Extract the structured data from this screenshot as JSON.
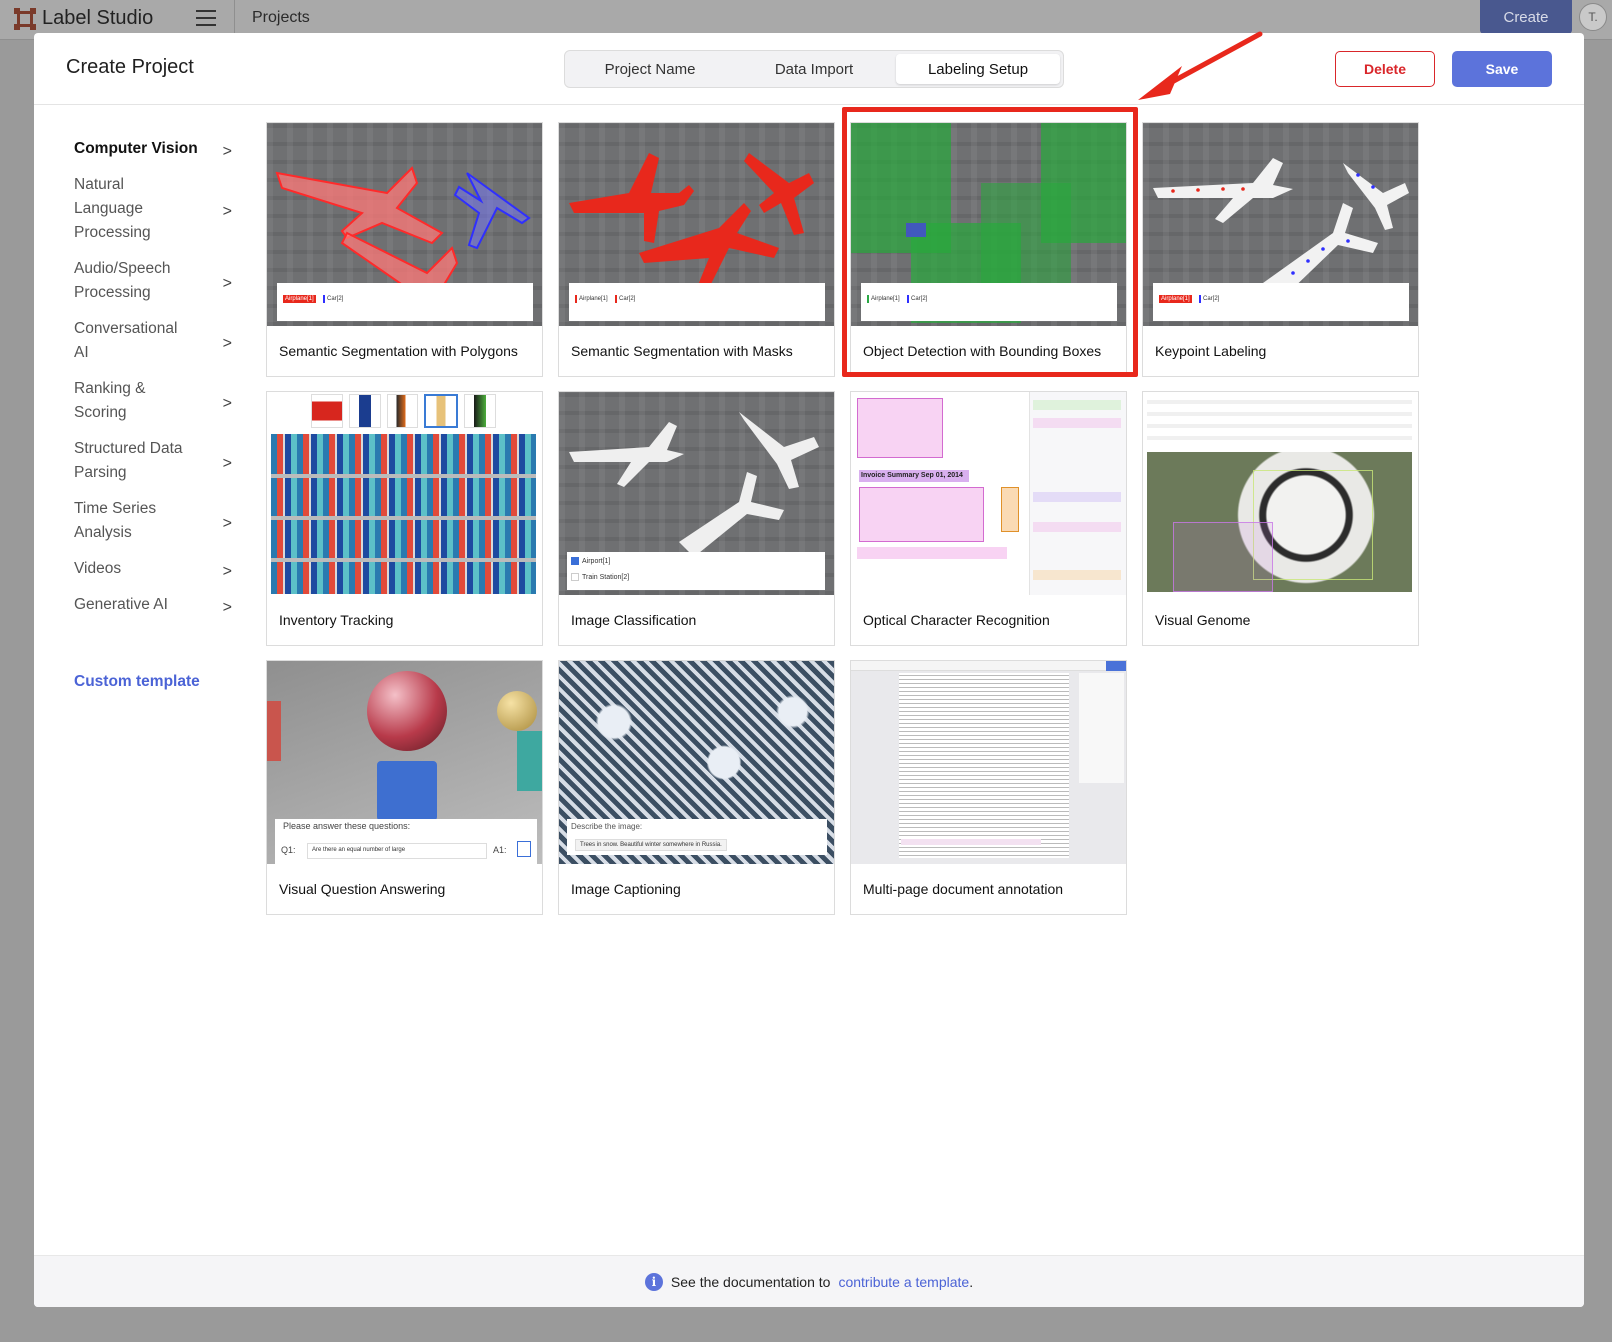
{
  "app": {
    "title": "Label Studio",
    "breadcrumb": "Projects",
    "create_label": "Create",
    "avatar_initial": "T."
  },
  "modal": {
    "title": "Create Project",
    "steps": [
      "Project Name",
      "Data Import",
      "Labeling Setup"
    ],
    "active_step": "Labeling Setup",
    "delete_label": "Delete",
    "save_label": "Save"
  },
  "sidebar": {
    "categories": [
      {
        "label": "Computer Vision",
        "active": true
      },
      {
        "label": "Natural Language Processing"
      },
      {
        "label": "Audio/Speech Processing"
      },
      {
        "label": "Conversational AI"
      },
      {
        "label": "Ranking & Scoring"
      },
      {
        "label": "Structured Data Parsing"
      },
      {
        "label": "Time Series Analysis"
      },
      {
        "label": "Videos"
      },
      {
        "label": "Generative AI"
      }
    ],
    "custom_template": "Custom template",
    "chevron": ">"
  },
  "templates": [
    {
      "label": "Semantic Segmentation with Polygons",
      "tags": [
        "Airplane[1]",
        "Car[2]"
      ]
    },
    {
      "label": "Semantic Segmentation with Masks",
      "tags": [
        "Airplane[1]",
        "Car[2]"
      ]
    },
    {
      "label": "Object Detection with Bounding Boxes",
      "tags": [
        "Airplane[1]",
        "Car[2]"
      ],
      "selected": true
    },
    {
      "label": "Keypoint Labeling",
      "tags": [
        "Airplane[1]",
        "Car[2]"
      ]
    },
    {
      "label": "Inventory Tracking"
    },
    {
      "label": "Image Classification",
      "options": [
        "Airport[1]",
        "Train Station[2]"
      ]
    },
    {
      "label": "Optical Character Recognition",
      "snippet": "Invoice Summary Sep 01, 2014"
    },
    {
      "label": "Visual Genome"
    },
    {
      "label": "Visual Question Answering",
      "prompt": "Please answer these questions:",
      "q": "Q1:",
      "a": "A1:",
      "question_text": "Are there an equal number of large"
    },
    {
      "label": "Image Captioning",
      "prompt": "Describe the image:",
      "caption": "Trees in snow. Beautiful winter somewhere in Russia."
    },
    {
      "label": "Multi-page document annotation"
    }
  ],
  "footer": {
    "prefix": "See the documentation to",
    "link": "contribute a template",
    "suffix": "."
  },
  "colors": {
    "primary": "#5c73db",
    "danger": "#d9262a",
    "highlight": "#e8281c"
  }
}
